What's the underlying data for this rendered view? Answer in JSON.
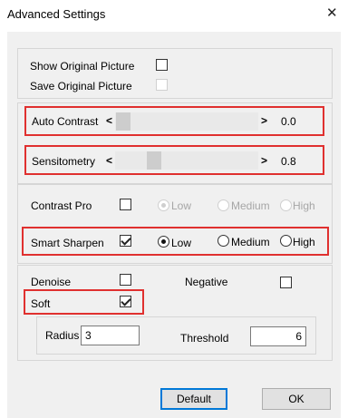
{
  "window": {
    "title": "Advanced Settings"
  },
  "picture": {
    "show_original_label": "Show Original Picture",
    "show_original_checked": false,
    "save_original_label": "Save Original Picture",
    "save_original_checked": false
  },
  "sliders": {
    "auto_contrast": {
      "label": "Auto Contrast",
      "left_arrow": "<",
      "right_arrow": ">",
      "value": "0.0"
    },
    "sensitometry": {
      "label": "Sensitometry",
      "left_arrow": "<",
      "right_arrow": ">",
      "value": "0.8"
    }
  },
  "contrast_pro": {
    "label": "Contrast Pro",
    "checked": false,
    "options": [
      "Low",
      "Medium",
      "High"
    ],
    "selected": "Low"
  },
  "smart_sharpen": {
    "label": "Smart Sharpen",
    "checked": true,
    "options": [
      "Low",
      "Medium",
      "High"
    ],
    "selected": "Low"
  },
  "denoise": {
    "label": "Denoise",
    "checked": false
  },
  "negative": {
    "label": "Negative",
    "checked": false
  },
  "soft": {
    "label": "Soft",
    "checked": true,
    "radius_label": "Radius",
    "radius_value": "3",
    "threshold_label": "Threshold",
    "threshold_value": "6"
  },
  "buttons": {
    "default": "Default",
    "ok": "OK"
  },
  "colors": {
    "highlight": "#e0302f",
    "panel": "#f0f0f0",
    "default_focus": "#0078d7"
  }
}
